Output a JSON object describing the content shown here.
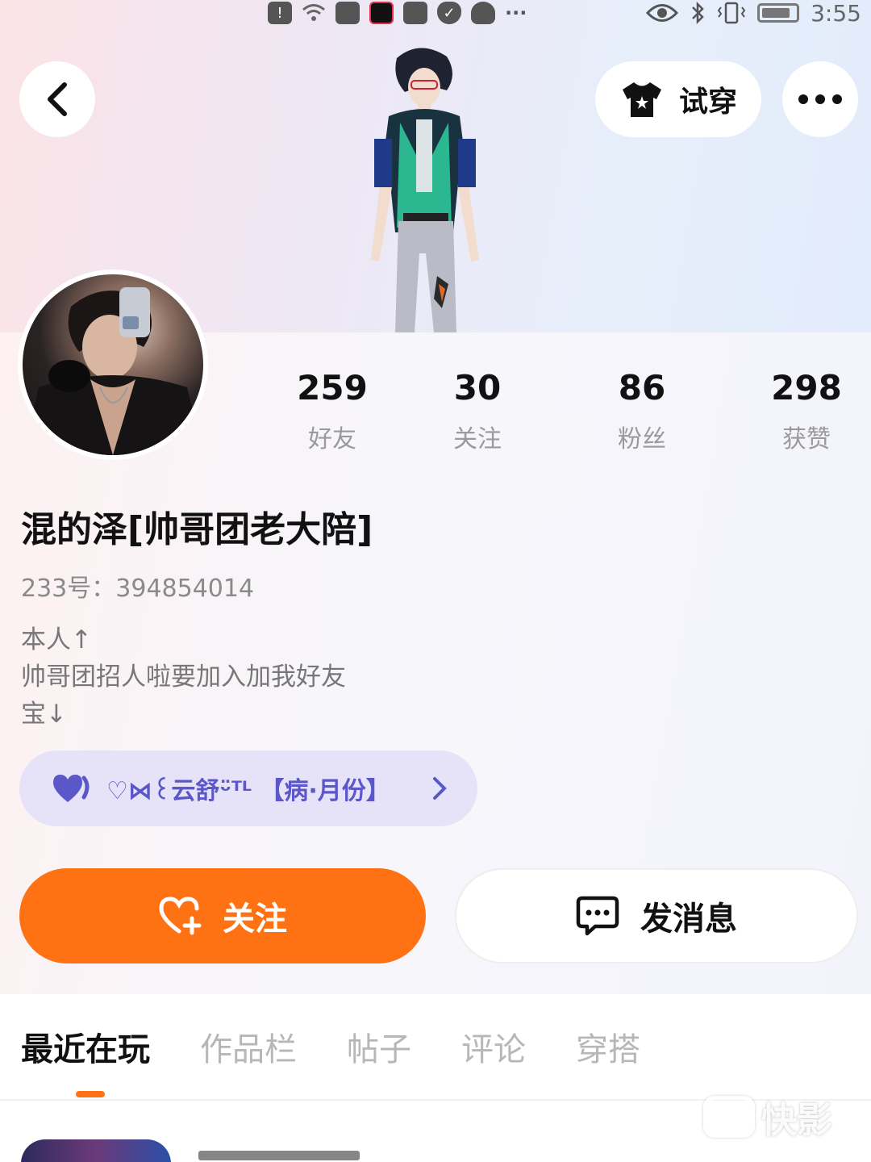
{
  "status_bar": {
    "time": "3:55",
    "left_icons": [
      "alert-icon",
      "wifi-icon",
      "bag-icon",
      "recording-icon",
      "bag-icon",
      "shield-icon",
      "penguin-icon",
      "more-dots-icon"
    ],
    "right_icons": [
      "eye-icon",
      "bluetooth-icon",
      "vibrate-icon",
      "battery-icon"
    ]
  },
  "header": {
    "back_icon": "chevron-left-icon",
    "try_on_label": "试穿",
    "try_on_icon": "tshirt-icon",
    "more_icon": "more-dots-icon"
  },
  "profile": {
    "stats": [
      {
        "value": "259",
        "label": "好友"
      },
      {
        "value": "30",
        "label": "关注"
      },
      {
        "value": "86",
        "label": "粉丝"
      },
      {
        "value": "298",
        "label": "获赞"
      }
    ],
    "nickname": "混的泽[帅哥团老大陪]",
    "uid_label": "233号：",
    "uid_value": "394854014",
    "bio": "本人↑\n帅哥团招人啦要加入加我好友\n宝↓",
    "guild": {
      "name": "♡⋈꒰云舒ᵕ̈ᵀᴸ 【病·月份】",
      "heart_icon": "heart-icon",
      "arrow_icon": "chevron-right-icon"
    }
  },
  "actions": {
    "follow_label": "关注",
    "follow_icon": "heart-plus-icon",
    "message_label": "发消息",
    "message_icon": "chat-bubble-icon"
  },
  "tabs": {
    "items": [
      "最近在玩",
      "作品栏",
      "帖子",
      "评论",
      "穿搭"
    ],
    "active_index": 0
  },
  "watermark": {
    "text": "快影"
  },
  "colors": {
    "accent": "#ff7214",
    "guild_bg": "#e6e3f8",
    "guild_text": "#5b57c9"
  }
}
